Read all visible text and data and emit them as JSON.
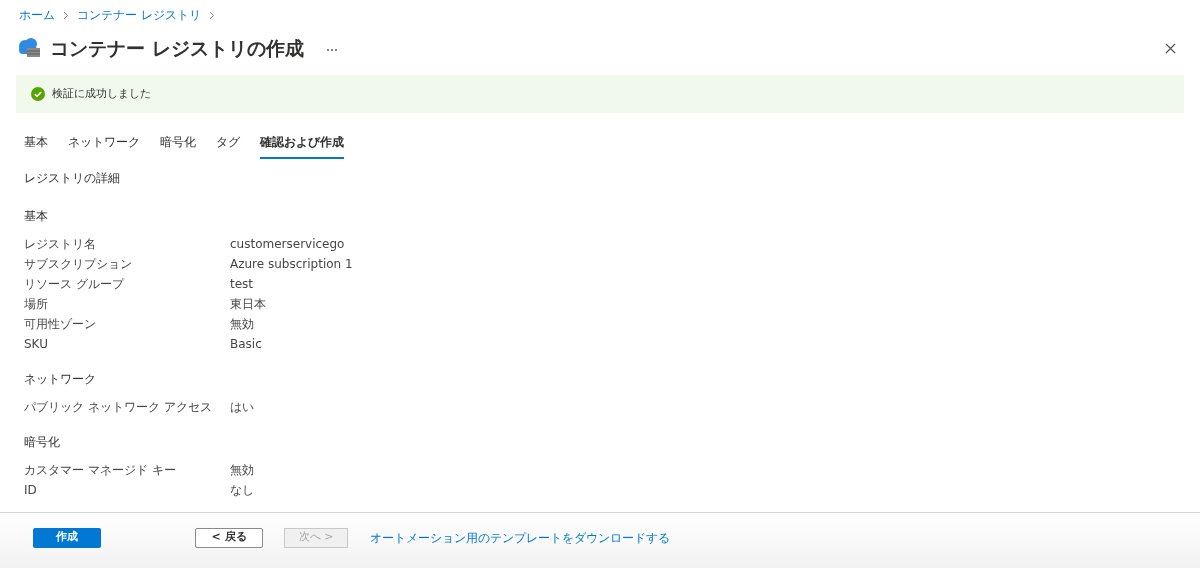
{
  "breadcrumb": [
    "ホーム",
    "コンテナー レジストリ"
  ],
  "title": "コンテナー レジストリの作成",
  "banner": {
    "text": "検証に成功しました"
  },
  "tabs": [
    {
      "label": "基本",
      "selected": false
    },
    {
      "label": "ネットワーク",
      "selected": false
    },
    {
      "label": "暗号化",
      "selected": false
    },
    {
      "label": "タグ",
      "selected": false
    },
    {
      "label": "確認および作成",
      "selected": true
    }
  ],
  "section_title": "レジストリの詳細",
  "groups": [
    {
      "title": "基本",
      "rows": [
        {
          "label": "レジストリ名",
          "value": "customerservicego"
        },
        {
          "label": "サブスクリプション",
          "value": "Azure subscription 1"
        },
        {
          "label": "リソース グループ",
          "value": "test"
        },
        {
          "label": "場所",
          "value": "東日本"
        },
        {
          "label": "可用性ゾーン",
          "value": "無効"
        },
        {
          "label": "SKU",
          "value": "Basic"
        }
      ]
    },
    {
      "title": "ネットワーク",
      "rows": [
        {
          "label": "パブリック ネットワーク アクセス",
          "value": "はい"
        }
      ]
    },
    {
      "title": "暗号化",
      "rows": [
        {
          "label": "カスタマー マネージド キー",
          "value": "無効"
        },
        {
          "label": "ID",
          "value": "なし"
        }
      ]
    }
  ],
  "footer": {
    "buttons": [
      {
        "label": "作成",
        "kind": "primary",
        "disabled": false
      },
      {
        "label": "< 戻る",
        "kind": "secondary",
        "disabled": false
      },
      {
        "label": "次へ >",
        "kind": "secondary",
        "disabled": true
      }
    ],
    "link": "オートメーション用のテンプレートをダウンロードする"
  }
}
